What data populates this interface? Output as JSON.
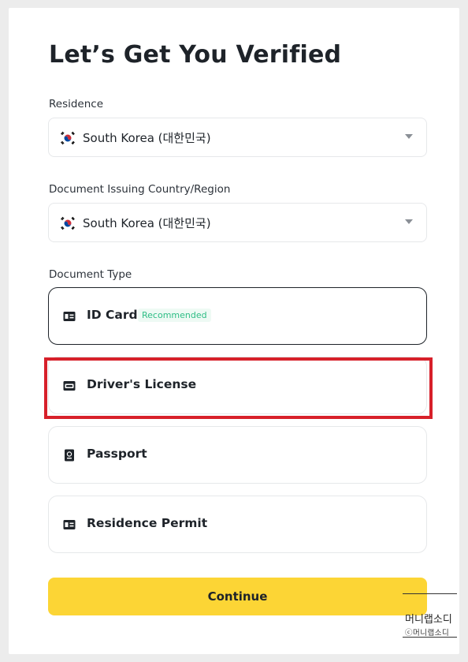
{
  "page": {
    "title": "Let’s Get You Verified"
  },
  "residence": {
    "label": "Residence",
    "value": "South Korea (대한민국)",
    "flag_icon": "south-korea-flag-icon"
  },
  "issuing_country": {
    "label": "Document Issuing Country/Region",
    "value": "South Korea (대한민국)",
    "flag_icon": "south-korea-flag-icon"
  },
  "document_type": {
    "label": "Document Type",
    "options": [
      {
        "label": "ID Card",
        "badge": "Recommended",
        "icon": "id-card-icon",
        "selected": true
      },
      {
        "label": "Driver's License",
        "icon": "drivers-license-icon",
        "selected": false
      },
      {
        "label": "Passport",
        "icon": "passport-icon",
        "selected": false
      },
      {
        "label": "Residence Permit",
        "icon": "residence-permit-icon",
        "selected": false
      }
    ]
  },
  "actions": {
    "continue_label": "Continue"
  },
  "watermark": {
    "text": "머니랩소디",
    "copyright": "ⓒ머니랩소디"
  },
  "colors": {
    "accent_button": "#fcd535",
    "highlight_box": "#d7202a",
    "badge_text": "#2ebd85",
    "text_primary": "#1e2329"
  }
}
